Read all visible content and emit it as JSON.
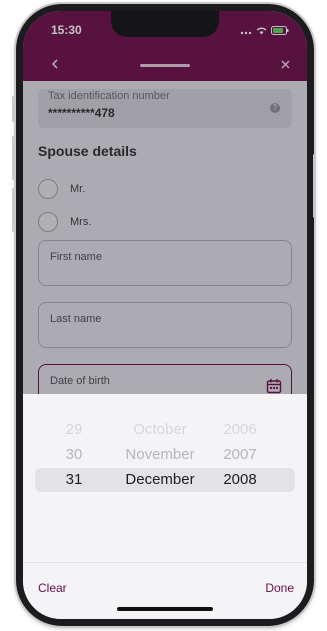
{
  "status_bar": {
    "time": "15:30"
  },
  "header": {
    "back_icon": "chevron-left-icon",
    "close_icon": "close-icon"
  },
  "tax_field": {
    "label": "Tax identification number",
    "value": "**********478"
  },
  "spouse": {
    "title": "Spouse details",
    "options": [
      {
        "label": "Mr."
      },
      {
        "label": "Mrs."
      }
    ],
    "first_name_label": "First name",
    "last_name_label": "Last name",
    "dob_label": "Date of birth"
  },
  "picker": {
    "rows": [
      {
        "day": "29",
        "month": "October",
        "year": "2006"
      },
      {
        "day": "30",
        "month": "November",
        "year": "2007"
      },
      {
        "day": "31",
        "month": "December",
        "year": "2008"
      }
    ],
    "clear_label": "Clear",
    "done_label": "Done"
  },
  "colors": {
    "brand": "#6b0b47",
    "accent_text": "#6b0b47"
  }
}
